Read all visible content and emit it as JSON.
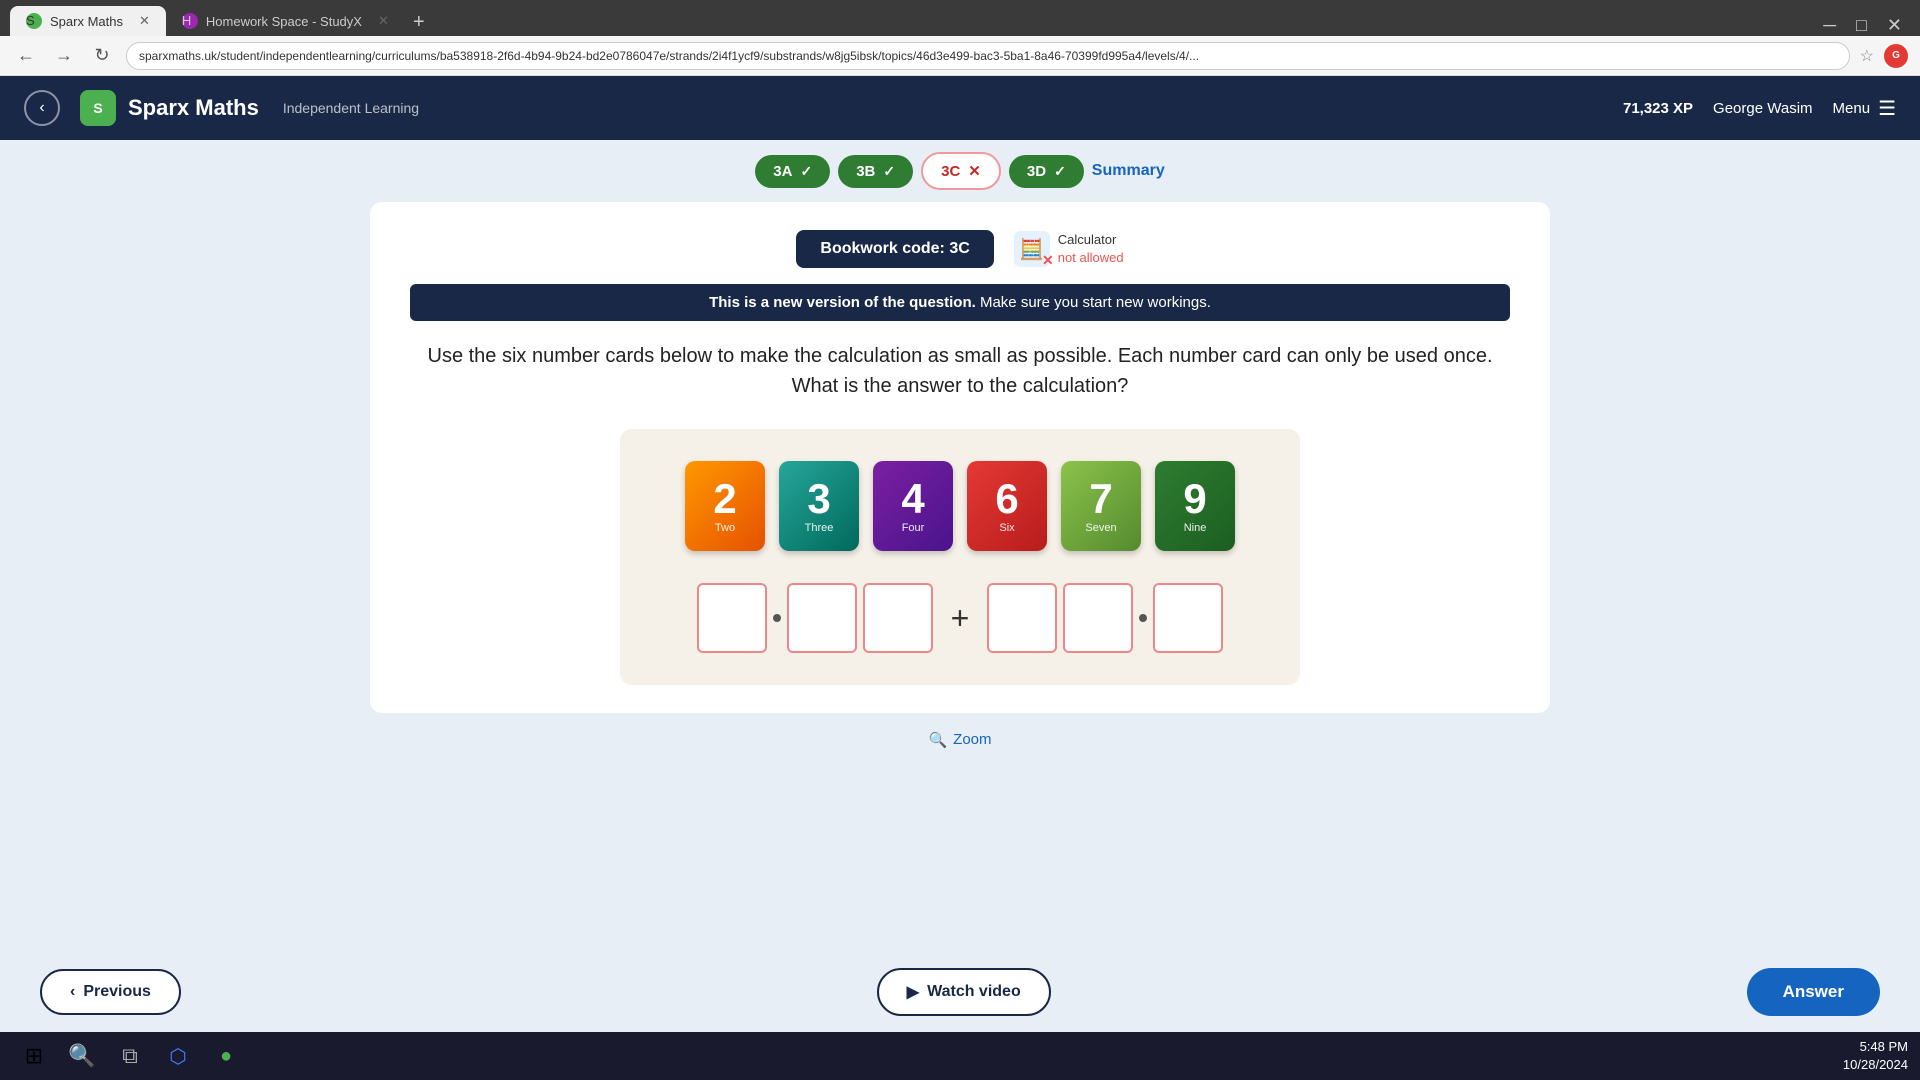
{
  "browser": {
    "tabs": [
      {
        "label": "Sparx Maths",
        "active": true,
        "icon": "S"
      },
      {
        "label": "Homework Space - StudyX",
        "active": false,
        "icon": "H"
      }
    ],
    "address": "sparxmaths.uk/student/independentlearning/curriculums/ba538918-2f6d-4b94-9b24-bd2e0786047e/strands/2i4f1ycf9/substrands/w8jg5ibsk/topics/46d3e499-bac3-5ba1-8a46-70399fd995a4/levels/4/..."
  },
  "header": {
    "back_label": "‹",
    "logo": "Sparx Maths",
    "subtitle": "Independent Learning",
    "xp": "71,323 XP",
    "user": "George Wasim",
    "menu": "Menu"
  },
  "question_tabs": [
    {
      "id": "3A",
      "status": "correct",
      "label": "3A"
    },
    {
      "id": "3B",
      "status": "correct",
      "label": "3B"
    },
    {
      "id": "3C",
      "status": "wrong",
      "label": "3C"
    },
    {
      "id": "3D",
      "status": "correct",
      "label": "3D"
    },
    {
      "id": "summary",
      "status": "summary",
      "label": "Summary"
    }
  ],
  "bookwork": {
    "label": "Bookwork code: 3C"
  },
  "calculator": {
    "status": "not allowed",
    "label": "Calculator",
    "sublabel": "not allowed"
  },
  "banner": {
    "bold": "This is a new version of the question.",
    "text": " Make sure you start new workings."
  },
  "question": {
    "text": "Use the six number cards below to make the calculation as small as possible. Each number card can only be used once. What is the answer to the calculation?"
  },
  "cards": [
    {
      "number": "2",
      "word": "Two",
      "color": "orange"
    },
    {
      "number": "3",
      "word": "Three",
      "color": "teal"
    },
    {
      "number": "4",
      "word": "Four",
      "color": "purple"
    },
    {
      "number": "6",
      "word": "Six",
      "color": "red"
    },
    {
      "number": "7",
      "word": "Seven",
      "color": "lime"
    },
    {
      "number": "9",
      "word": "Nine",
      "color": "green"
    }
  ],
  "zoom": {
    "label": "Zoom"
  },
  "buttons": {
    "previous": "‹ Previous",
    "watch_video": "Watch video",
    "answer": "Answer"
  },
  "taskbar": {
    "time": "5:48 PM",
    "date": "10/28/2024"
  }
}
